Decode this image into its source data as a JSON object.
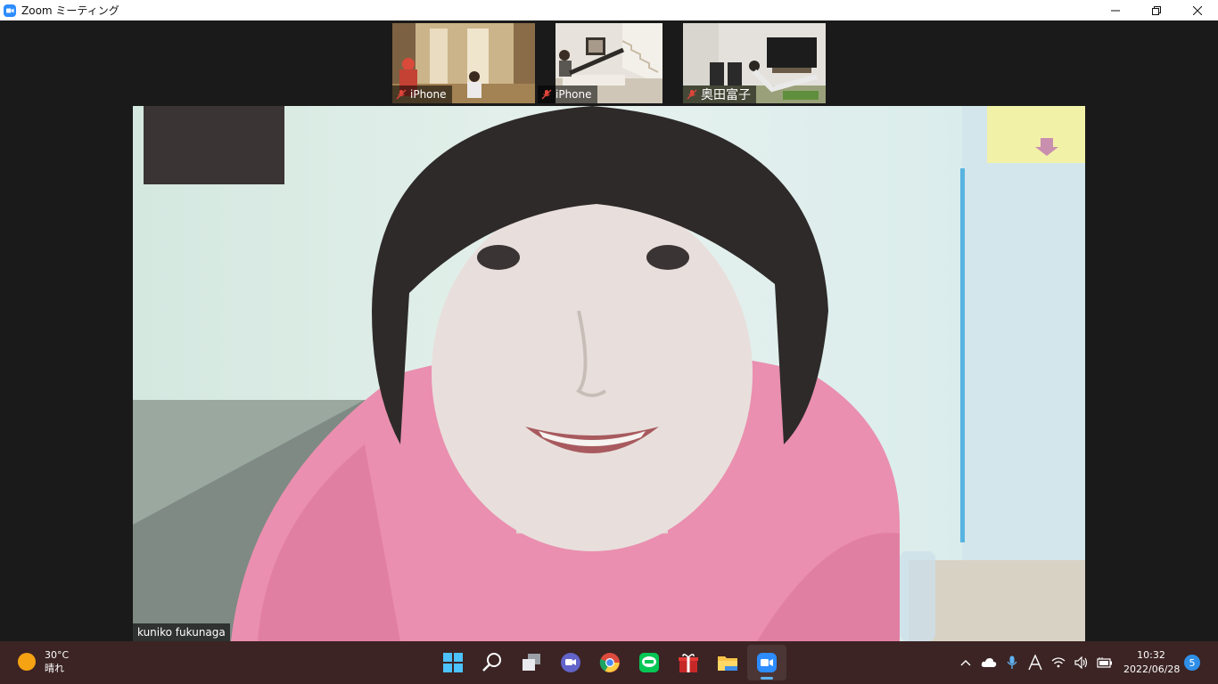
{
  "window": {
    "title": "Zoom ミーティング",
    "icons": [
      "zoom-app-icon",
      "minimize-icon",
      "restore-icon",
      "close-icon"
    ]
  },
  "participants": [
    {
      "name": "iPhone",
      "muted": true
    },
    {
      "name": "iPhone",
      "muted": true
    },
    {
      "name": "奥田富子",
      "muted": true
    }
  ],
  "main_speaker": {
    "name": "kuniko fukunaga"
  },
  "taskbar": {
    "weather": {
      "temp": "30°C",
      "condition": "晴れ"
    },
    "apps": [
      "windows-start-icon",
      "search-icon",
      "task-view-icon",
      "teams-chat-icon",
      "chrome-icon",
      "line-icon",
      "gift-icon",
      "file-explorer-icon",
      "zoom-icon"
    ],
    "clock": {
      "time": "10:32",
      "date": "2022/06/28"
    },
    "notifications": "5"
  },
  "colors": {
    "zoom_blue": "#2d8cff",
    "taskbar": "#3c2424",
    "muted_red": "#e0453a"
  }
}
